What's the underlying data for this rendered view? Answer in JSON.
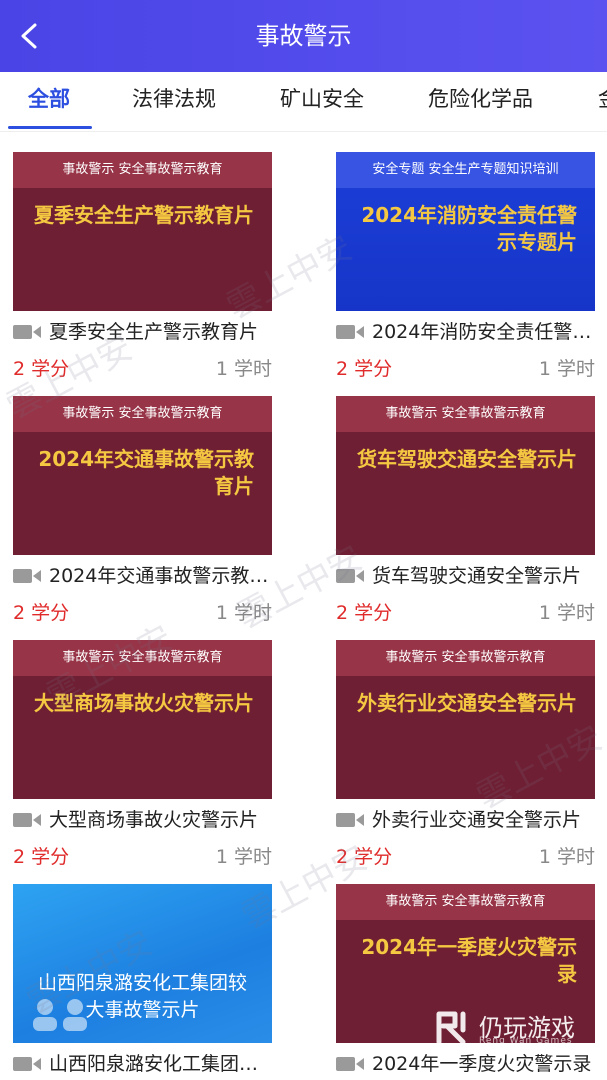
{
  "header": {
    "title": "事故警示"
  },
  "tabs": [
    {
      "label": "全部",
      "active": true
    },
    {
      "label": "法律法规"
    },
    {
      "label": "矿山安全"
    },
    {
      "label": "危险化学品"
    },
    {
      "label": "金"
    }
  ],
  "courses": [
    {
      "band": "事故警示 安全事故警示教育",
      "headline": "夏季安全生产警示教育片",
      "title": "夏季安全生产警示教育片",
      "credit": "2 学分",
      "hours": "1 学时",
      "style": "red"
    },
    {
      "band": "安全专题 安全生产专题知识培训",
      "headline": "2024年消防安全责任警示专题片",
      "title": "2024年消防安全责任警示专题片",
      "credit": "2 学分",
      "hours": "1 学时",
      "style": "blue"
    },
    {
      "band": "事故警示 安全事故警示教育",
      "headline": "2024年交通事故警示教育片",
      "title": "2024年交通事故警示教育片",
      "credit": "2 学分",
      "hours": "1 学时",
      "style": "red"
    },
    {
      "band": "事故警示 安全事故警示教育",
      "headline": "货车驾驶交通安全警示片",
      "title": "货车驾驶交通安全警示片",
      "credit": "2 学分",
      "hours": "1 学时",
      "style": "red"
    },
    {
      "band": "事故警示 安全事故警示教育",
      "headline": "大型商场事故火灾警示片",
      "title": "大型商场事故火灾警示片",
      "credit": "2 学分",
      "hours": "1 学时",
      "style": "red"
    },
    {
      "band": "事故警示 安全事故警示教育",
      "headline": "外卖行业交通安全警示片",
      "title": "外卖行业交通安全警示片",
      "credit": "2 学分",
      "hours": "1 学时",
      "style": "red"
    },
    {
      "band": "",
      "headline": "山西阳泉潞安化工集团较大事故警示片",
      "title": "山西阳泉潞安化工集团较大事故警示片",
      "credit": "",
      "hours": "",
      "style": "sky"
    },
    {
      "band": "事故警示 安全事故警示教育",
      "headline": "2024年一季度火灾警示录",
      "title": "2024年一季度火灾警示录",
      "credit": "",
      "hours": "",
      "style": "red"
    }
  ],
  "watermark": "雲上中安",
  "corner_logo": {
    "name": "仍玩游戏",
    "sub": "Reng Wan Games"
  },
  "colors": {
    "header": "#4a44e6",
    "active_tab": "#2d4fe0",
    "credit": "#e02b2b",
    "card_red": "#6f1f33",
    "band_red": "#973447",
    "headline": "#f5c842"
  }
}
